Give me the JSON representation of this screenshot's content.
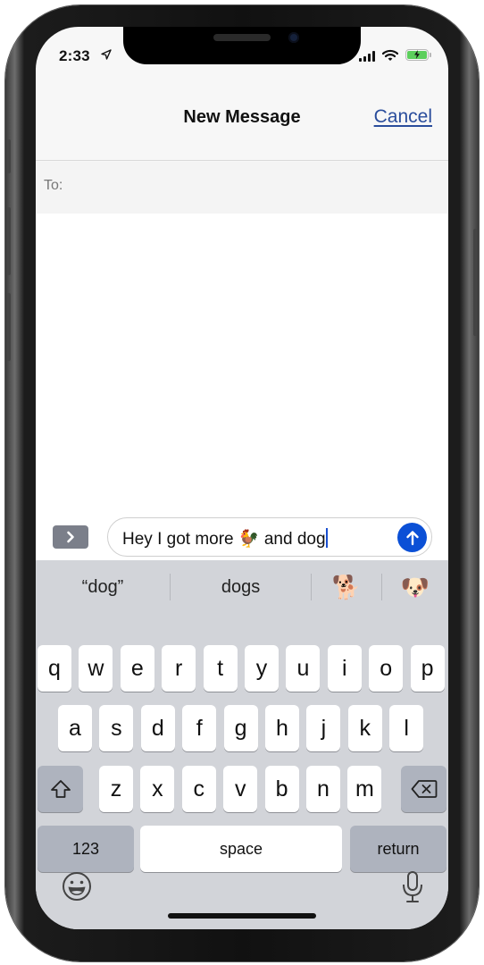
{
  "status_bar": {
    "time": "2:33",
    "location_icon": "location-arrow-icon",
    "signal_icon": "cellular-signal-icon",
    "wifi_icon": "wifi-icon",
    "battery_icon": "battery-charging-icon",
    "battery_color": "#5ccf5c"
  },
  "nav": {
    "title": "New Message",
    "cancel_label": "Cancel",
    "cancel_color": "#2a4d9c"
  },
  "recipient": {
    "label": "To:",
    "value": ""
  },
  "compose": {
    "expand_icon": "chevron-right-icon",
    "text_before": "Hey I got more ",
    "emoji": "🐓",
    "text_after": " and dog",
    "send_icon": "arrow-up-icon",
    "send_color": "#0b50d6"
  },
  "suggestions": [
    {
      "label": "“dog”"
    },
    {
      "label": "dogs"
    },
    {
      "label": "🐕"
    },
    {
      "label": "🐶"
    }
  ],
  "keyboard": {
    "row1": [
      "q",
      "w",
      "e",
      "r",
      "t",
      "y",
      "u",
      "i",
      "o",
      "p"
    ],
    "row2": [
      "a",
      "s",
      "d",
      "f",
      "g",
      "h",
      "j",
      "k",
      "l"
    ],
    "row3": [
      "z",
      "x",
      "c",
      "v",
      "b",
      "n",
      "m"
    ],
    "shift_icon": "shift-icon",
    "delete_icon": "backspace-icon",
    "numbers_label": "123",
    "space_label": "space",
    "return_label": "return",
    "emoji_icon": "emoji-icon",
    "mic_icon": "microphone-icon"
  }
}
